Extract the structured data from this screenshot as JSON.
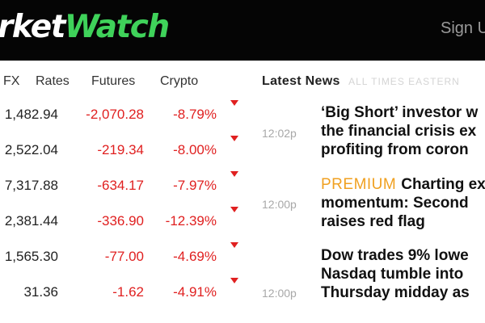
{
  "header": {
    "logo_white": "rket",
    "logo_green": "Watch",
    "signin_label": "Sign U"
  },
  "tabs": [
    {
      "label": "FX"
    },
    {
      "label": "Rates"
    },
    {
      "label": "Futures"
    },
    {
      "label": "Crypto"
    }
  ],
  "quotes": [
    {
      "last": "1,482.94",
      "change": "-2,070.28",
      "pct": "-8.79%"
    },
    {
      "last": "2,522.04",
      "change": "-219.34",
      "pct": "-8.00%"
    },
    {
      "last": "7,317.88",
      "change": "-634.17",
      "pct": "-7.97%"
    },
    {
      "last": "2,381.44",
      "change": "-336.90",
      "pct": "-12.39%"
    },
    {
      "last": "1,565.30",
      "change": "-77.00",
      "pct": "-4.69%"
    },
    {
      "last": "31.36",
      "change": "-1.62",
      "pct": "-4.91%"
    }
  ],
  "colors": {
    "brand_green": "#3fd25a",
    "negative": "#e02020",
    "premium": "#f0a020",
    "header_bg": "#050505"
  },
  "icons": {
    "down_arrow": "down-triangle-icon"
  },
  "news": {
    "title": "Latest News",
    "timezone": "ALL TIMES EASTERN",
    "items": [
      {
        "time": "12:02p",
        "premium": "",
        "lines": [
          "‘Big Short’ investor w",
          "the financial crisis ex",
          "profiting from coron"
        ]
      },
      {
        "time": "12:00p",
        "premium": "PREMIUM",
        "lines": [
          "Charting ex",
          "momentum: Second",
          "raises red flag"
        ]
      },
      {
        "time": "12:00p",
        "premium": "",
        "lines": [
          "Dow trades 9% lowe",
          "Nasdaq tumble into",
          "Thursday midday as"
        ]
      }
    ]
  }
}
